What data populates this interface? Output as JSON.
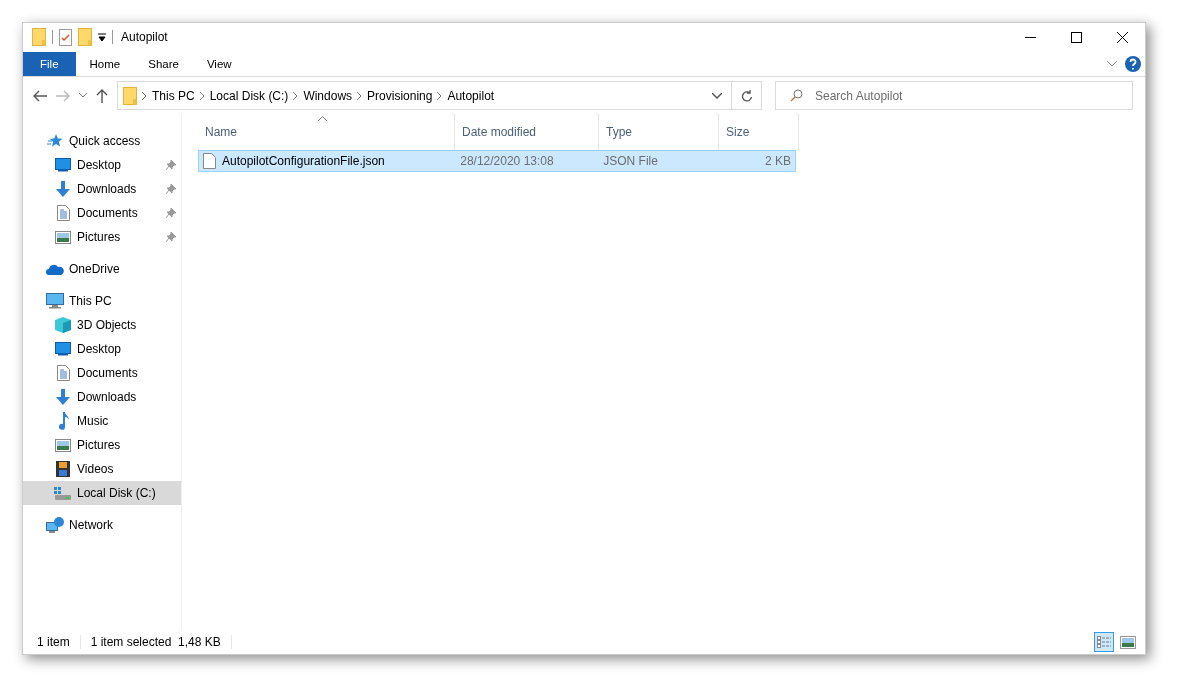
{
  "window": {
    "title": "Autopilot"
  },
  "ribbon_tabs": [
    {
      "label": "File",
      "selected": true
    },
    {
      "label": "Home",
      "selected": false
    },
    {
      "label": "Share",
      "selected": false
    },
    {
      "label": "View",
      "selected": false
    }
  ],
  "address": {
    "path": [
      "This PC",
      "Local Disk (C:)",
      "Windows",
      "Provisioning",
      "Autopilot"
    ]
  },
  "search": {
    "placeholder": "Search Autopilot"
  },
  "sidebar": {
    "items": [
      {
        "label": "Quick access",
        "selected": false,
        "children": [
          {
            "label": "Desktop",
            "pinned": true,
            "selected": false
          },
          {
            "label": "Downloads",
            "pinned": true,
            "selected": false
          },
          {
            "label": "Documents",
            "pinned": true,
            "selected": false
          },
          {
            "label": "Pictures",
            "pinned": true,
            "selected": false
          }
        ]
      },
      {
        "label": "OneDrive",
        "selected": false
      },
      {
        "label": "This PC",
        "selected": false,
        "children": [
          {
            "label": "3D Objects",
            "selected": false
          },
          {
            "label": "Desktop",
            "selected": false
          },
          {
            "label": "Documents",
            "selected": false
          },
          {
            "label": "Downloads",
            "selected": false
          },
          {
            "label": "Music",
            "selected": false
          },
          {
            "label": "Pictures",
            "selected": false
          },
          {
            "label": "Videos",
            "selected": false
          },
          {
            "label": "Local Disk (C:)",
            "selected": true
          }
        ]
      },
      {
        "label": "Network",
        "selected": false
      }
    ]
  },
  "table": {
    "columns": [
      "Name",
      "Date modified",
      "Type",
      "Size"
    ],
    "rows": [
      {
        "name": "AutopilotConfigurationFile.json",
        "date": "28/12/2020 13:08",
        "type": "JSON File",
        "size": "2 KB",
        "selected": true
      }
    ]
  },
  "status_bar": {
    "count": "1 item",
    "selection": "1 item selected  1,48 KB"
  }
}
